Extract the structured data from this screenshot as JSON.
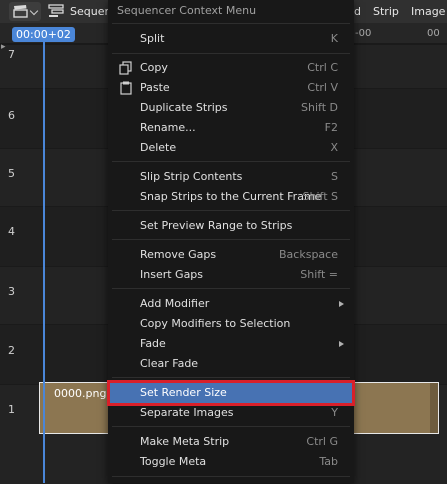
{
  "header": {
    "editor_icon": "clapperboard-icon",
    "mode_label": "Sequencer",
    "menus": [
      "d",
      "Strip",
      "Image"
    ]
  },
  "timeline": {
    "current_time": "00:00+02",
    "ruler_ticks": [
      "-00",
      "00"
    ]
  },
  "channels": [
    "7",
    "6",
    "5",
    "4",
    "3",
    "2",
    "1"
  ],
  "strip": {
    "label": "0000.png"
  },
  "menu": {
    "title": "Sequencer Context Menu",
    "items": [
      {
        "label": "Split",
        "shortcut": "K"
      },
      {
        "label": "Copy",
        "shortcut": "Ctrl C",
        "icon": "copy-icon"
      },
      {
        "label": "Paste",
        "shortcut": "Ctrl V",
        "icon": "paste-icon"
      },
      {
        "label": "Duplicate Strips",
        "shortcut": "Shift D"
      },
      {
        "label": "Rename...",
        "shortcut": "F2"
      },
      {
        "label": "Delete",
        "shortcut": "X"
      },
      {
        "label": "Slip Strip Contents",
        "shortcut": "S"
      },
      {
        "label": "Snap Strips to the Current Frame",
        "shortcut": "Shift S"
      },
      {
        "label": "Set Preview Range to Strips",
        "shortcut": ""
      },
      {
        "label": "Remove Gaps",
        "shortcut": "Backspace"
      },
      {
        "label": "Insert Gaps",
        "shortcut": "Shift ="
      },
      {
        "label": "Add Modifier",
        "shortcut": "",
        "submenu": true
      },
      {
        "label": "Copy Modifiers to Selection",
        "shortcut": ""
      },
      {
        "label": "Fade",
        "shortcut": "",
        "submenu": true
      },
      {
        "label": "Clear Fade",
        "shortcut": ""
      },
      {
        "label": "Set Render Size",
        "shortcut": "",
        "highlighted": true
      },
      {
        "label": "Separate Images",
        "shortcut": "Y"
      },
      {
        "label": "Make Meta Strip",
        "shortcut": "Ctrl G"
      },
      {
        "label": "Toggle Meta",
        "shortcut": "Tab"
      }
    ]
  },
  "colors": {
    "highlight": "#4772b3",
    "annotation_outline": "#d9202a",
    "playhead": "#4a86d8",
    "strip": "#8c7651"
  }
}
